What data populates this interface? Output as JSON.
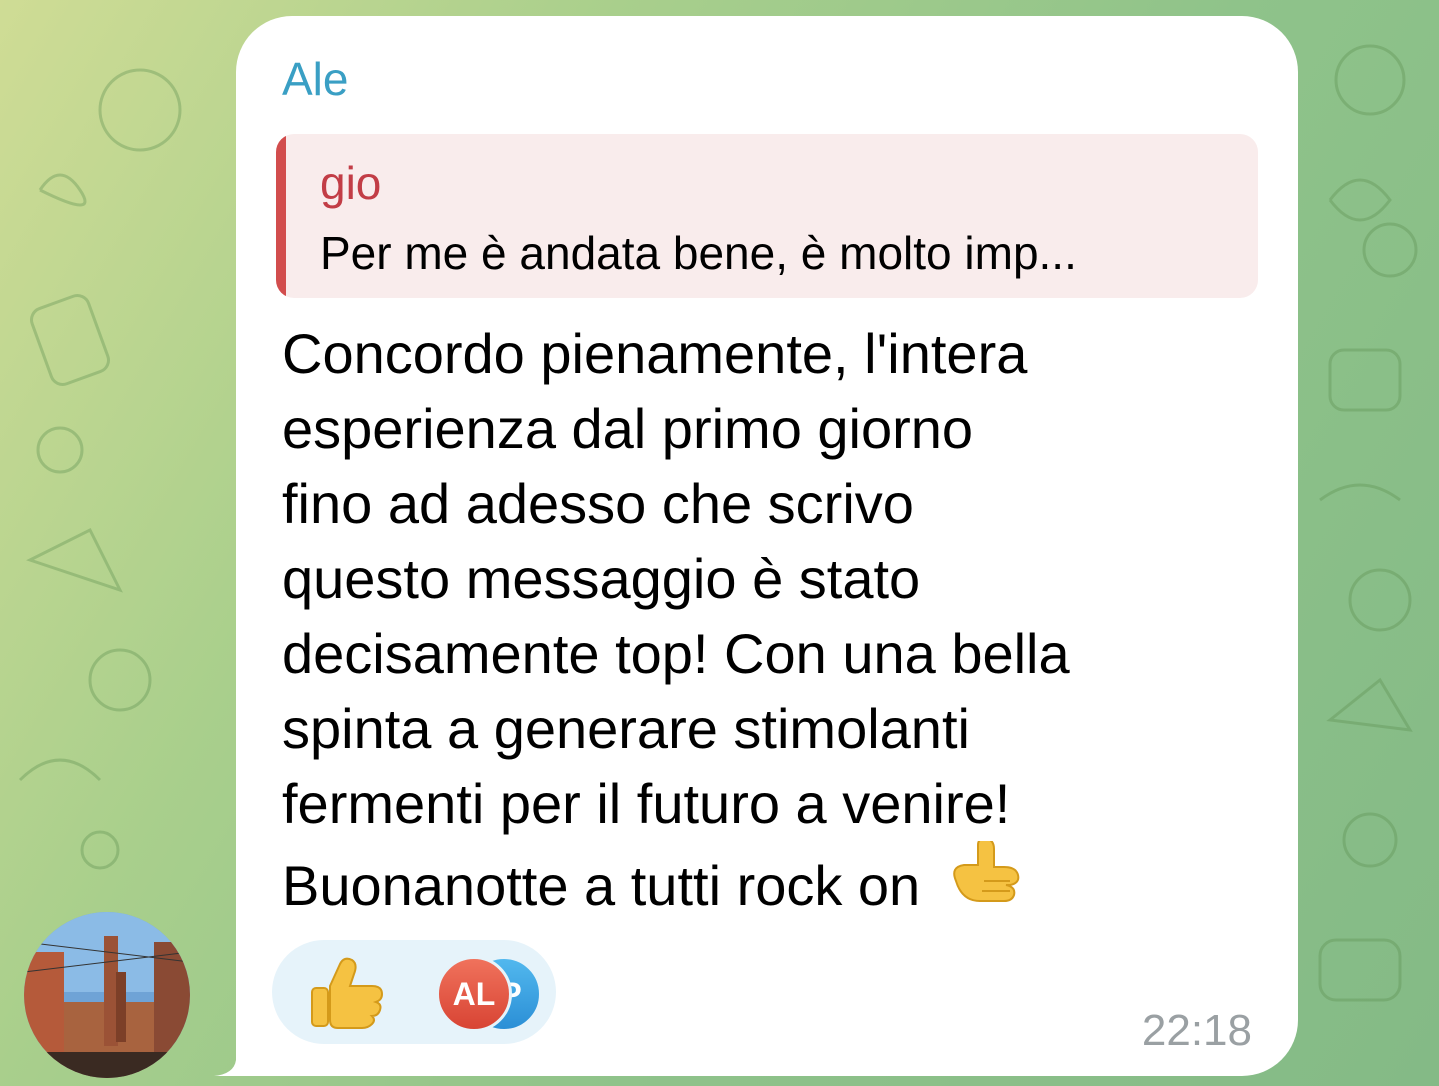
{
  "chat": {
    "sender": "Ale",
    "reply": {
      "author": "gio",
      "text": "Per me è andata bene, è molto imp..."
    },
    "message_lines": [
      "Concordo pienamente, l'intera",
      "esperienza dal primo giorno",
      "fino ad adesso che scrivo",
      "questo messaggio è stato",
      "decisamente top! Con una bella",
      "spinta a generare stimolanti",
      "fermenti per il futuro a venire!",
      "Buonanotte a tutti rock on"
    ],
    "message_emoji": "call-me-hand-emoji",
    "reaction": {
      "emoji": "thumbs-up-emoji",
      "avatars": [
        {
          "initials": "AL",
          "color": "#e05a45"
        },
        {
          "initials": "P",
          "color": "#3fa6e6"
        }
      ]
    },
    "time": "22:18"
  },
  "colors": {
    "sender": "#3a9fc4",
    "reply_accent": "#d24d4d",
    "reply_bg": "#f9ecec",
    "reaction_bg": "#e6f3fa"
  }
}
